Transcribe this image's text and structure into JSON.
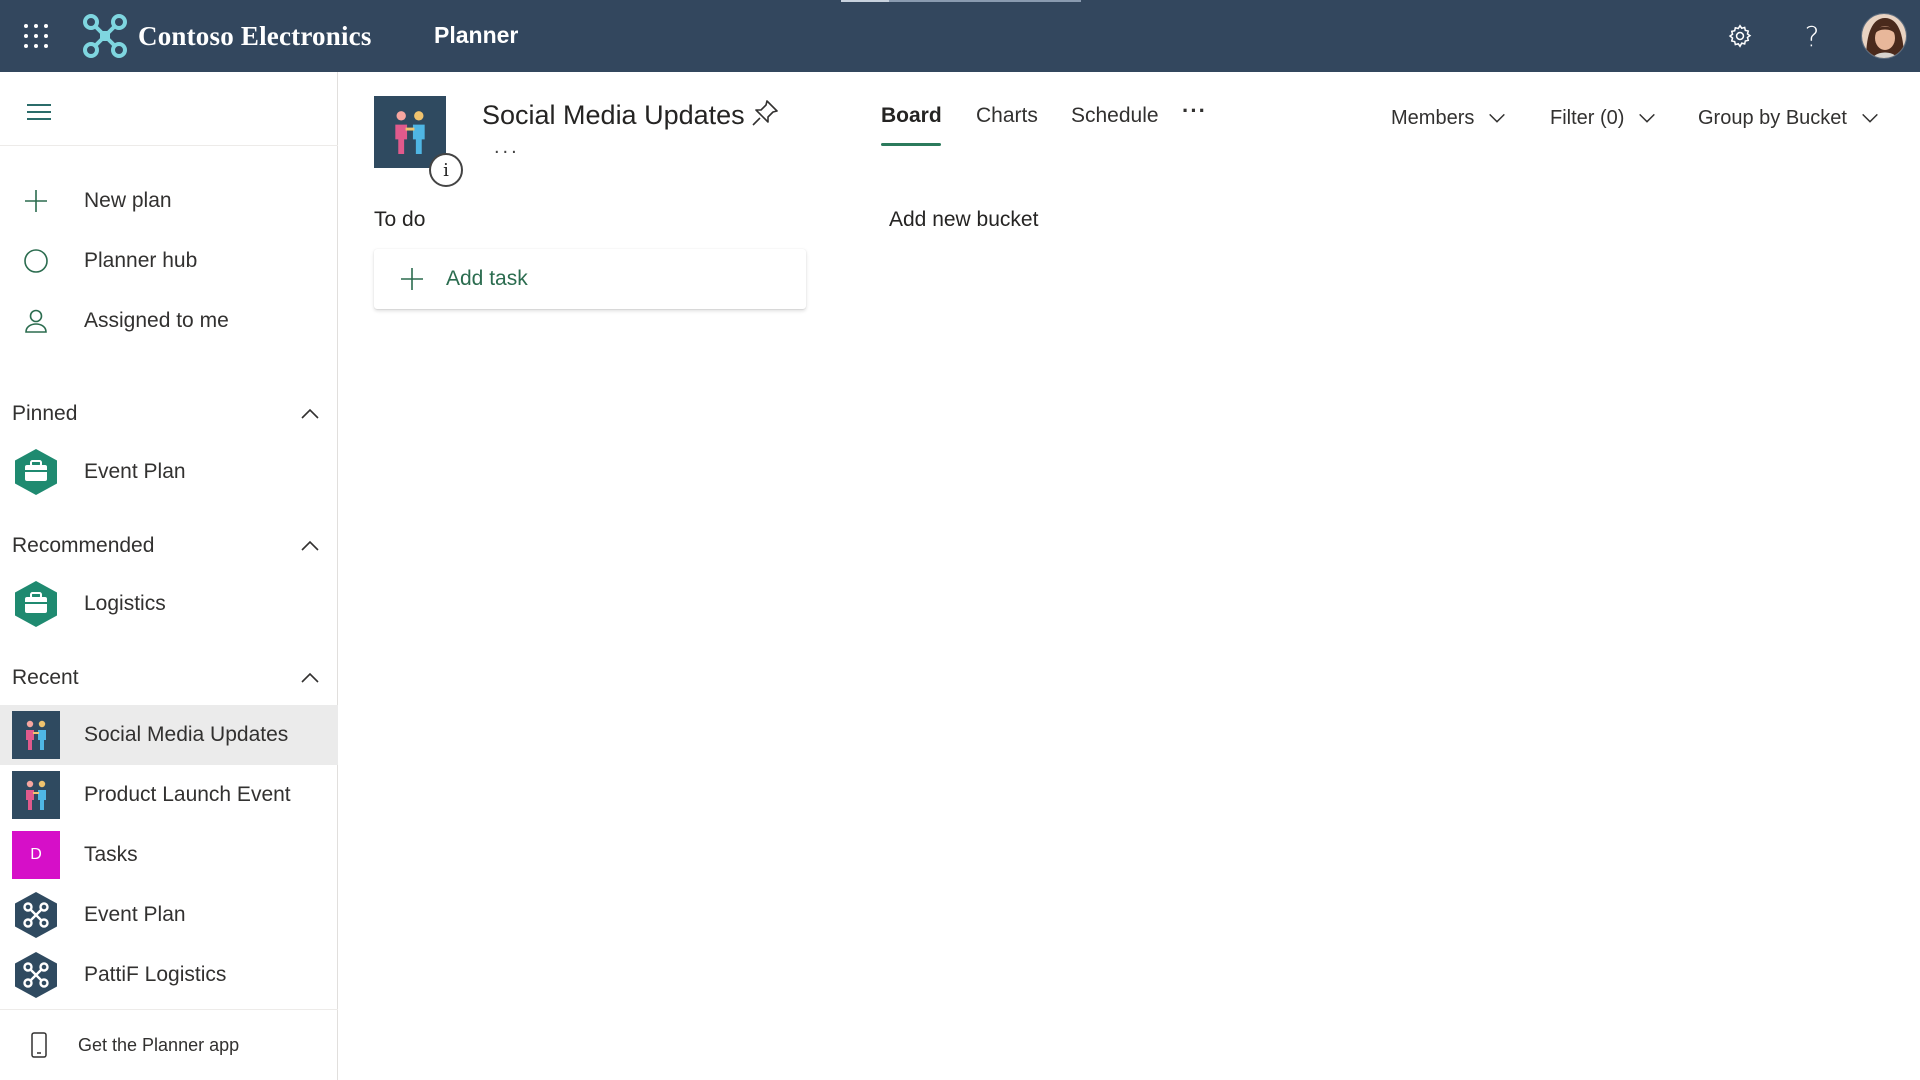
{
  "header": {
    "brand": "Contoso Electronics",
    "app_name": "Planner",
    "settings_icon": "gear-icon",
    "help_icon": "help-icon",
    "help_glyph": "?"
  },
  "nav": {
    "items": [
      {
        "label": "New plan",
        "icon": "plus-icon"
      },
      {
        "label": "Planner hub",
        "icon": "circle-icon"
      },
      {
        "label": "Assigned to me",
        "icon": "person-icon"
      }
    ],
    "pinned": {
      "title": "Pinned",
      "items": [
        {
          "label": "Event Plan",
          "icon": "briefcase-hexagon-icon"
        }
      ]
    },
    "recommended": {
      "title": "Recommended",
      "items": [
        {
          "label": "Logistics",
          "icon": "briefcase-hexagon-icon"
        }
      ]
    },
    "recent": {
      "title": "Recent",
      "items": [
        {
          "label": "Social Media Updates",
          "icon": "people-thumbnail-icon",
          "selected": true
        },
        {
          "label": "Product Launch Event",
          "icon": "people-thumbnail-icon"
        },
        {
          "label": "Tasks",
          "icon": "letter-thumbnail",
          "letter": "D",
          "color": "#d60fc8"
        },
        {
          "label": "Event Plan",
          "icon": "drone-hexagon-icon"
        },
        {
          "label": "PattiF Logistics",
          "icon": "drone-hexagon-icon"
        }
      ]
    },
    "get_app": "Get the Planner app"
  },
  "plan": {
    "title": "Social Media Updates",
    "more": "...",
    "info_glyph": "i",
    "tabs": [
      {
        "label": "Board",
        "active": true
      },
      {
        "label": "Charts"
      },
      {
        "label": "Schedule"
      }
    ],
    "tab_more": "···",
    "toolbar": {
      "members": "Members",
      "filter": "Filter (0)",
      "group_by": "Group by Bucket"
    }
  },
  "board": {
    "buckets": [
      {
        "name": "To do",
        "add_task_label": "Add task"
      }
    ],
    "add_bucket": "Add new bucket"
  },
  "colors": {
    "topbar": "#33475e",
    "accent_green": "#2b7a5c",
    "selected_row": "#ebebeb",
    "thumbnail_bg": "#2f4a60",
    "hexagon_teal": "#1f8a70"
  }
}
